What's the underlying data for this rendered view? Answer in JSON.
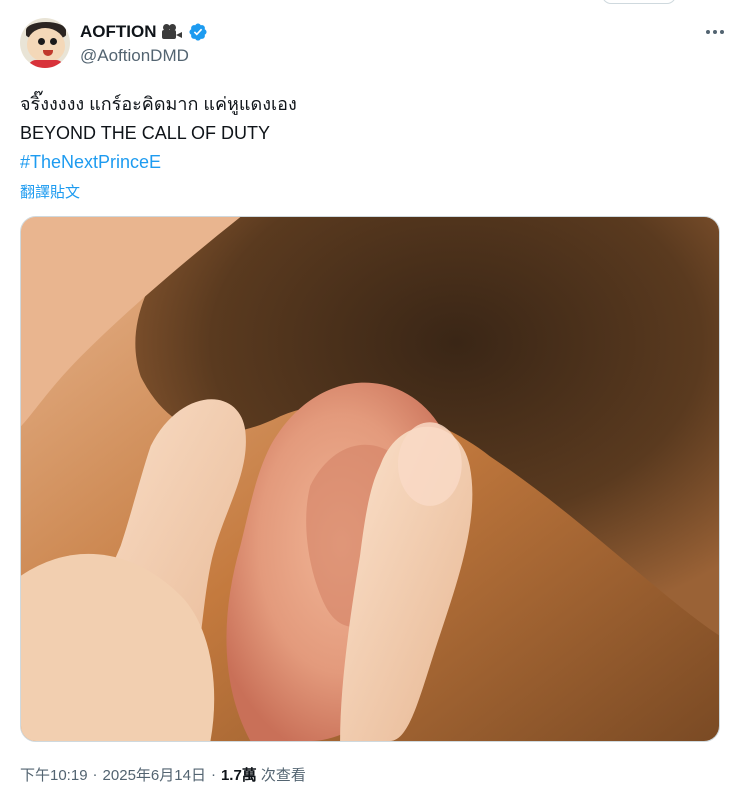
{
  "tweet": {
    "display_name": "AOFTION",
    "name_emoji": "movie-camera-emoji",
    "handle": "@AoftionDMD",
    "verified": true,
    "text_line1": "จริ๊งงงงง แกร์อะคิดมาก แค่หูแดงเอง",
    "text_line2": "BEYOND THE CALL OF DUTY",
    "hashtag": "#TheNextPrinceE",
    "translate_link": "翻譯貼文",
    "time": "下午10:19",
    "date": "2025年6月14日",
    "separator": "·",
    "views_count": "1.7萬",
    "views_label": "次查看"
  },
  "colors": {
    "accent": "#1d9bf0",
    "secondary_text": "#536471",
    "primary_text": "#0f1419"
  },
  "icons": {
    "verified": "verified-badge-icon",
    "more": "more-dots-icon"
  }
}
